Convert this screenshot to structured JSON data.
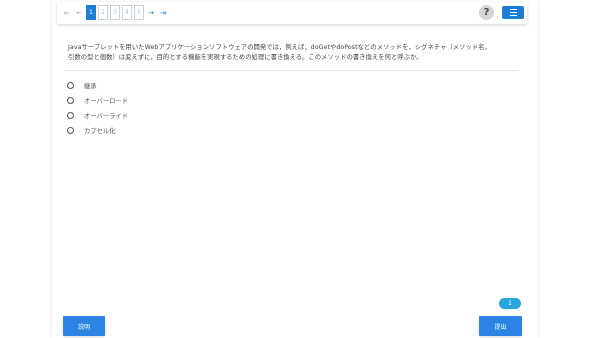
{
  "toolbar": {
    "pager": {
      "first_icon": "⇤",
      "prev_icon": "←",
      "pages": [
        "1",
        "2",
        "3",
        "4",
        "5"
      ],
      "active_page": "1",
      "next_icon": "→",
      "last_icon": "⇥"
    },
    "help_label": "?",
    "grid_icon": "grid-icon"
  },
  "question": {
    "line1": "Javaサーブレットを用いたWebアプリケーションソフトウェアの開発では，例えば，doGetやdoPostなどのメソッドを，シグネチャ（メソッド名，",
    "line2": "引数の型と個数）は変えずに，目的とする機能を実現するための処理に書き換える。このメソッドの書き換えを何と呼ぶか。"
  },
  "options": [
    {
      "label": "継承"
    },
    {
      "label": "オーバーロード"
    },
    {
      "label": "オーバーライド"
    },
    {
      "label": "カプセル化"
    }
  ],
  "pill_label": "1",
  "buttons": {
    "explain": "説明",
    "submit": "提出"
  },
  "colors": {
    "accent": "#1c7fd6",
    "button": "#2b84e4",
    "pill": "#25a6dc"
  }
}
